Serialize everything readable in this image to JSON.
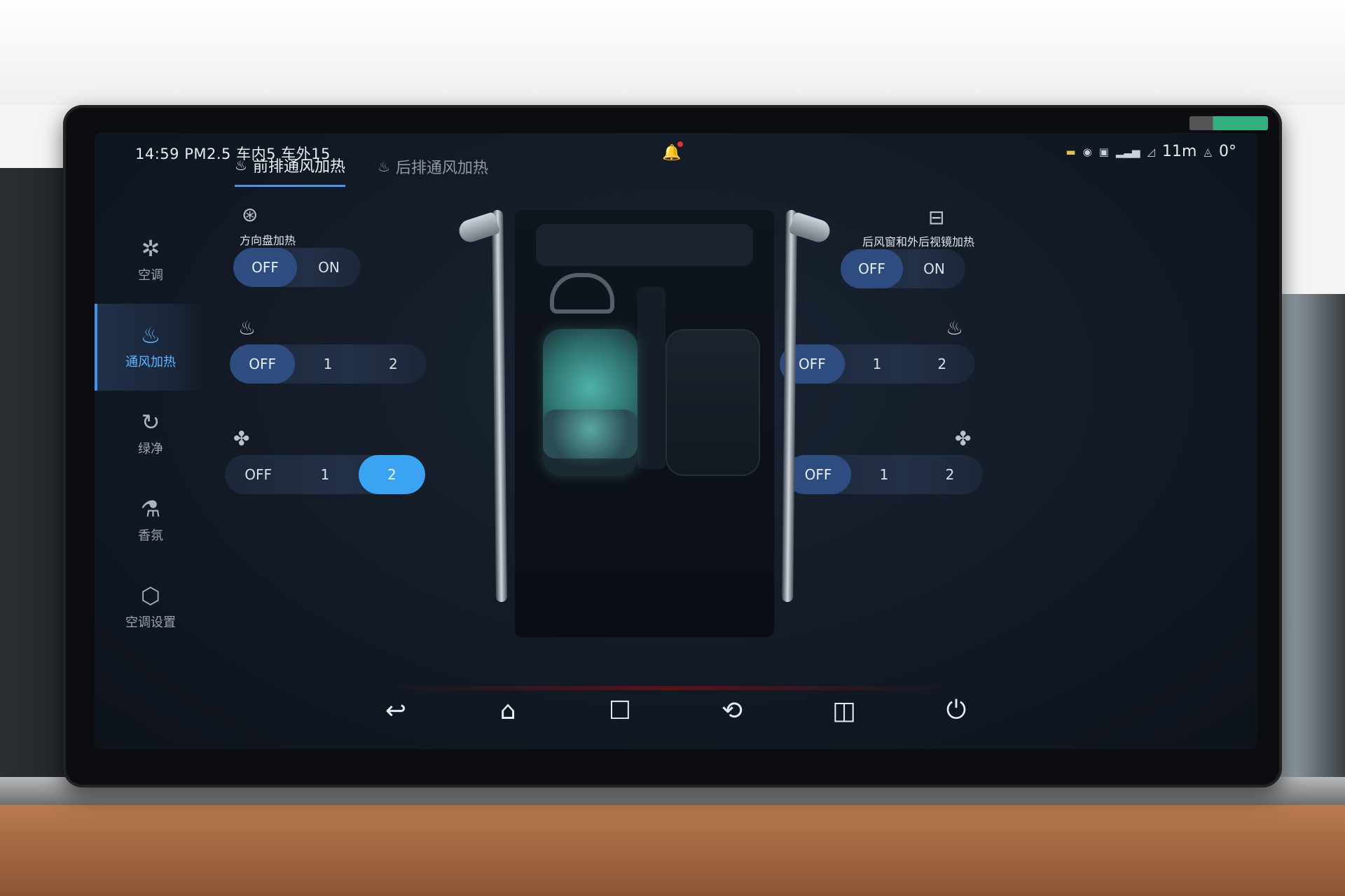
{
  "status": {
    "time": "14:59",
    "pm25": "PM2.5",
    "inside_label": "车内5",
    "outside_label": "车外15",
    "signal": "11m",
    "angle": "0°"
  },
  "sidebar": {
    "items": [
      {
        "label": "空调",
        "icon": "fan-icon"
      },
      {
        "label": "通风加热",
        "icon": "seat-heat-icon",
        "active": true
      },
      {
        "label": "绿净",
        "icon": "air-purify-icon"
      },
      {
        "label": "香氛",
        "icon": "fragrance-icon"
      },
      {
        "label": "空调设置",
        "icon": "hexagon-settings-icon"
      }
    ]
  },
  "tabs": [
    {
      "label": "前排通风加热",
      "active": true
    },
    {
      "label": "后排通风加热",
      "active": false
    }
  ],
  "controls": {
    "steering_heat": {
      "label": "方向盘加热",
      "options": [
        "OFF",
        "ON"
      ],
      "selected": "OFF"
    },
    "rear_window_heat": {
      "label": "后风窗和外后视镜加热",
      "options": [
        "OFF",
        "ON"
      ],
      "selected": "OFF"
    },
    "left_seat_heat": {
      "options": [
        "OFF",
        "1",
        "2"
      ],
      "selected": "OFF"
    },
    "right_seat_heat": {
      "options": [
        "OFF",
        "1",
        "2"
      ],
      "selected": "OFF"
    },
    "left_seat_vent": {
      "options": [
        "OFF",
        "1",
        "2"
      ],
      "selected": "2"
    },
    "right_seat_vent": {
      "options": [
        "OFF",
        "1",
        "2"
      ],
      "selected": "OFF"
    }
  },
  "navbar": [
    "back-icon",
    "home-icon",
    "recent-apps-icon",
    "rotate-screen-icon",
    "split-screen-icon",
    "screen-off-icon"
  ],
  "colors": {
    "accent": "#3aa3f2",
    "selected_dim": "#2f4c80",
    "background": "#121924"
  }
}
